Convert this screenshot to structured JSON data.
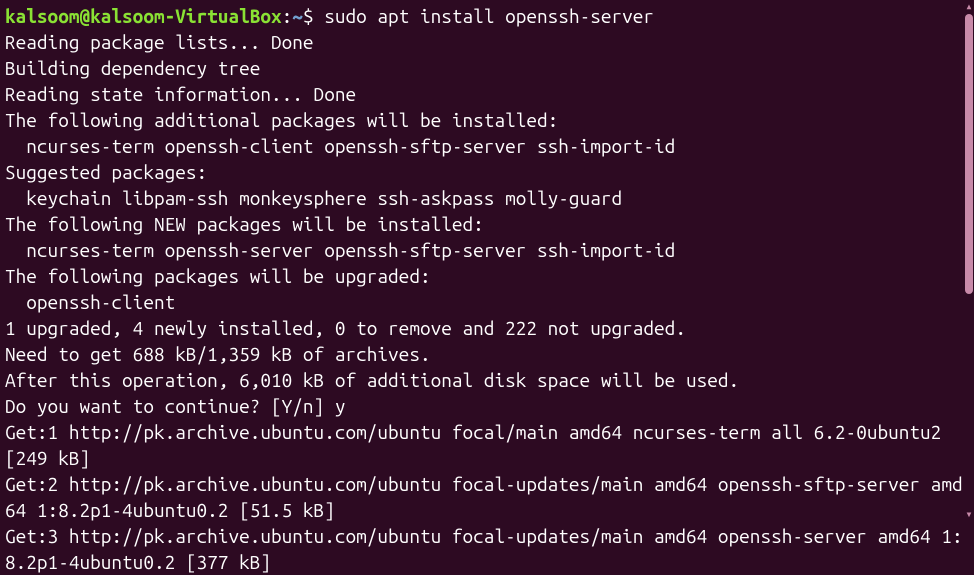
{
  "prompt": {
    "user": "kalsoom",
    "at": "@",
    "host": "kalsoom-VirtualBox",
    "sep": ":",
    "path": "~",
    "dollar": "$"
  },
  "command": "sudo apt install openssh-server",
  "lines": {
    "l0": "Reading package lists... Done",
    "l1": "Building dependency tree",
    "l2": "Reading state information... Done",
    "l3": "The following additional packages will be installed:",
    "l4": "  ncurses-term openssh-client openssh-sftp-server ssh-import-id",
    "l5": "Suggested packages:",
    "l6": "  keychain libpam-ssh monkeysphere ssh-askpass molly-guard",
    "l7": "The following NEW packages will be installed:",
    "l8": "  ncurses-term openssh-server openssh-sftp-server ssh-import-id",
    "l9": "The following packages will be upgraded:",
    "l10": "  openssh-client",
    "l11": "1 upgraded, 4 newly installed, 0 to remove and 222 not upgraded.",
    "l12": "Need to get 688 kB/1,359 kB of archives.",
    "l13": "After this operation, 6,010 kB of additional disk space will be used.",
    "l14": "Do you want to continue? [Y/n] y",
    "l15": "Get:1 http://pk.archive.ubuntu.com/ubuntu focal/main amd64 ncurses-term all 6.2-0ubuntu2 [249 kB]",
    "l16": "Get:2 http://pk.archive.ubuntu.com/ubuntu focal-updates/main amd64 openssh-sftp-server amd64 1:8.2p1-4ubuntu0.2 [51.5 kB]",
    "l17": "Get:3 http://pk.archive.ubuntu.com/ubuntu focal-updates/main amd64 openssh-server amd64 1:8.2p1-4ubuntu0.2 [377 kB]"
  }
}
